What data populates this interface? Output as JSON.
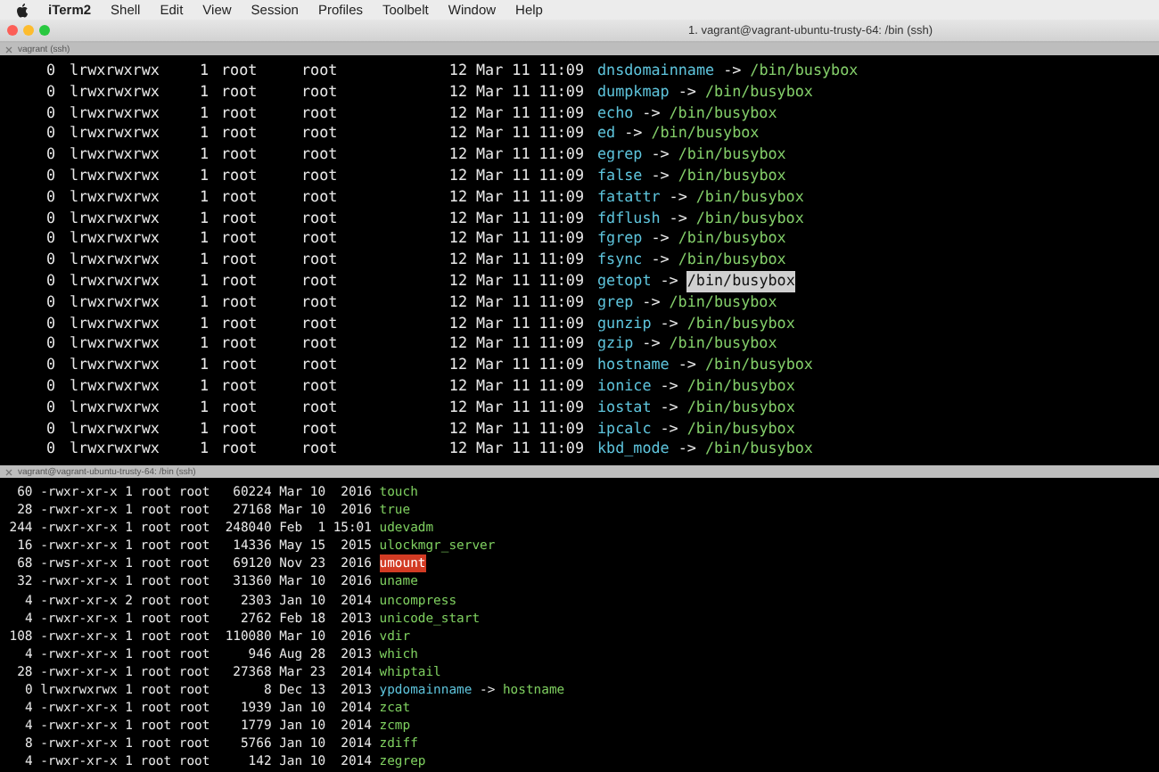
{
  "menu_bar": {
    "app": "iTerm2",
    "items": [
      "Shell",
      "Edit",
      "View",
      "Session",
      "Profiles",
      "Toolbelt",
      "Window",
      "Help"
    ]
  },
  "window": {
    "title": "1. vagrant@vagrant-ubuntu-trusty-64: /bin (ssh)"
  },
  "top_pane": {
    "tab_title": "vagrant (ssh)",
    "rows": [
      {
        "blocks": "0",
        "mode": "lrwxrwxrwx",
        "links": "1",
        "owner": "root",
        "group": "root",
        "size": "12",
        "date": "Mar 11 11:09",
        "name": "dnsdomainname",
        "arrow": "->",
        "target": "/bin/busybox",
        "selected": false
      },
      {
        "blocks": "0",
        "mode": "lrwxrwxrwx",
        "links": "1",
        "owner": "root",
        "group": "root",
        "size": "12",
        "date": "Mar 11 11:09",
        "name": "dumpkmap",
        "arrow": "->",
        "target": "/bin/busybox",
        "selected": false
      },
      {
        "blocks": "0",
        "mode": "lrwxrwxrwx",
        "links": "1",
        "owner": "root",
        "group": "root",
        "size": "12",
        "date": "Mar 11 11:09",
        "name": "echo",
        "arrow": "->",
        "target": "/bin/busybox",
        "selected": false
      },
      {
        "blocks": "0",
        "mode": "lrwxrwxrwx",
        "links": "1",
        "owner": "root",
        "group": "root",
        "size": "12",
        "date": "Mar 11 11:09",
        "name": "ed",
        "arrow": "->",
        "target": "/bin/busybox",
        "selected": false
      },
      {
        "blocks": "0",
        "mode": "lrwxrwxrwx",
        "links": "1",
        "owner": "root",
        "group": "root",
        "size": "12",
        "date": "Mar 11 11:09",
        "name": "egrep",
        "arrow": "->",
        "target": "/bin/busybox",
        "selected": false
      },
      {
        "blocks": "0",
        "mode": "lrwxrwxrwx",
        "links": "1",
        "owner": "root",
        "group": "root",
        "size": "12",
        "date": "Mar 11 11:09",
        "name": "false",
        "arrow": "->",
        "target": "/bin/busybox",
        "selected": false
      },
      {
        "blocks": "0",
        "mode": "lrwxrwxrwx",
        "links": "1",
        "owner": "root",
        "group": "root",
        "size": "12",
        "date": "Mar 11 11:09",
        "name": "fatattr",
        "arrow": "->",
        "target": "/bin/busybox",
        "selected": false
      },
      {
        "blocks": "0",
        "mode": "lrwxrwxrwx",
        "links": "1",
        "owner": "root",
        "group": "root",
        "size": "12",
        "date": "Mar 11 11:09",
        "name": "fdflush",
        "arrow": "->",
        "target": "/bin/busybox",
        "selected": false
      },
      {
        "blocks": "0",
        "mode": "lrwxrwxrwx",
        "links": "1",
        "owner": "root",
        "group": "root",
        "size": "12",
        "date": "Mar 11 11:09",
        "name": "fgrep",
        "arrow": "->",
        "target": "/bin/busybox",
        "selected": false
      },
      {
        "blocks": "0",
        "mode": "lrwxrwxrwx",
        "links": "1",
        "owner": "root",
        "group": "root",
        "size": "12",
        "date": "Mar 11 11:09",
        "name": "fsync",
        "arrow": "->",
        "target": "/bin/busybox",
        "selected": false
      },
      {
        "blocks": "0",
        "mode": "lrwxrwxrwx",
        "links": "1",
        "owner": "root",
        "group": "root",
        "size": "12",
        "date": "Mar 11 11:09",
        "name": "getopt",
        "arrow": "->",
        "target": "/bin/busybox",
        "selected": true
      },
      {
        "blocks": "0",
        "mode": "lrwxrwxrwx",
        "links": "1",
        "owner": "root",
        "group": "root",
        "size": "12",
        "date": "Mar 11 11:09",
        "name": "grep",
        "arrow": "->",
        "target": "/bin/busybox",
        "selected": false
      },
      {
        "blocks": "0",
        "mode": "lrwxrwxrwx",
        "links": "1",
        "owner": "root",
        "group": "root",
        "size": "12",
        "date": "Mar 11 11:09",
        "name": "gunzip",
        "arrow": "->",
        "target": "/bin/busybox",
        "selected": false
      },
      {
        "blocks": "0",
        "mode": "lrwxrwxrwx",
        "links": "1",
        "owner": "root",
        "group": "root",
        "size": "12",
        "date": "Mar 11 11:09",
        "name": "gzip",
        "arrow": "->",
        "target": "/bin/busybox",
        "selected": false
      },
      {
        "blocks": "0",
        "mode": "lrwxrwxrwx",
        "links": "1",
        "owner": "root",
        "group": "root",
        "size": "12",
        "date": "Mar 11 11:09",
        "name": "hostname",
        "arrow": "->",
        "target": "/bin/busybox",
        "selected": false
      },
      {
        "blocks": "0",
        "mode": "lrwxrwxrwx",
        "links": "1",
        "owner": "root",
        "group": "root",
        "size": "12",
        "date": "Mar 11 11:09",
        "name": "ionice",
        "arrow": "->",
        "target": "/bin/busybox",
        "selected": false
      },
      {
        "blocks": "0",
        "mode": "lrwxrwxrwx",
        "links": "1",
        "owner": "root",
        "group": "root",
        "size": "12",
        "date": "Mar 11 11:09",
        "name": "iostat",
        "arrow": "->",
        "target": "/bin/busybox",
        "selected": false
      },
      {
        "blocks": "0",
        "mode": "lrwxrwxrwx",
        "links": "1",
        "owner": "root",
        "group": "root",
        "size": "12",
        "date": "Mar 11 11:09",
        "name": "ipcalc",
        "arrow": "->",
        "target": "/bin/busybox",
        "selected": false
      },
      {
        "blocks": "0",
        "mode": "lrwxrwxrwx",
        "links": "1",
        "owner": "root",
        "group": "root",
        "size": "12",
        "date": "Mar 11 11:09",
        "name": "kbd_mode",
        "arrow": "->",
        "target": "/bin/busybox",
        "selected": false
      }
    ]
  },
  "bottom_pane": {
    "tab_title": "vagrant@vagrant-ubuntu-trusty-64: /bin (ssh)",
    "rows": [
      {
        "kind": "exec",
        "blocks": "60",
        "mode": "-rwxr-xr-x",
        "links": "1",
        "owner": "root",
        "group": "root",
        "size": "60224",
        "month": "Mar",
        "day": "10",
        "time": "2016",
        "name": "touch"
      },
      {
        "kind": "exec",
        "blocks": "28",
        "mode": "-rwxr-xr-x",
        "links": "1",
        "owner": "root",
        "group": "root",
        "size": "27168",
        "month": "Mar",
        "day": "10",
        "time": "2016",
        "name": "true"
      },
      {
        "kind": "exec",
        "blocks": "244",
        "mode": "-rwxr-xr-x",
        "links": "1",
        "owner": "root",
        "group": "root",
        "size": "248040",
        "month": "Feb",
        "day": "1",
        "time": "15:01",
        "name": "udevadm"
      },
      {
        "kind": "exec",
        "blocks": "16",
        "mode": "-rwxr-xr-x",
        "links": "1",
        "owner": "root",
        "group": "root",
        "size": "14336",
        "month": "May",
        "day": "15",
        "time": "2015",
        "name": "ulockmgr_server"
      },
      {
        "kind": "setuid",
        "blocks": "68",
        "mode": "-rwsr-xr-x",
        "links": "1",
        "owner": "root",
        "group": "root",
        "size": "69120",
        "month": "Nov",
        "day": "23",
        "time": "2016",
        "name": "umount"
      },
      {
        "kind": "exec",
        "blocks": "32",
        "mode": "-rwxr-xr-x",
        "links": "1",
        "owner": "root",
        "group": "root",
        "size": "31360",
        "month": "Mar",
        "day": "10",
        "time": "2016",
        "name": "uname"
      },
      {
        "kind": "exec",
        "blocks": "4",
        "mode": "-rwxr-xr-x",
        "links": "2",
        "owner": "root",
        "group": "root",
        "size": "2303",
        "month": "Jan",
        "day": "10",
        "time": "2014",
        "name": "uncompress"
      },
      {
        "kind": "exec",
        "blocks": "4",
        "mode": "-rwxr-xr-x",
        "links": "1",
        "owner": "root",
        "group": "root",
        "size": "2762",
        "month": "Feb",
        "day": "18",
        "time": "2013",
        "name": "unicode_start"
      },
      {
        "kind": "exec",
        "blocks": "108",
        "mode": "-rwxr-xr-x",
        "links": "1",
        "owner": "root",
        "group": "root",
        "size": "110080",
        "month": "Mar",
        "day": "10",
        "time": "2016",
        "name": "vdir"
      },
      {
        "kind": "exec",
        "blocks": "4",
        "mode": "-rwxr-xr-x",
        "links": "1",
        "owner": "root",
        "group": "root",
        "size": "946",
        "month": "Aug",
        "day": "28",
        "time": "2013",
        "name": "which"
      },
      {
        "kind": "exec",
        "blocks": "28",
        "mode": "-rwxr-xr-x",
        "links": "1",
        "owner": "root",
        "group": "root",
        "size": "27368",
        "month": "Mar",
        "day": "23",
        "time": "2014",
        "name": "whiptail"
      },
      {
        "kind": "symlink",
        "blocks": "0",
        "mode": "lrwxrwxrwx",
        "links": "1",
        "owner": "root",
        "group": "root",
        "size": "8",
        "month": "Dec",
        "day": "13",
        "time": "2013",
        "name": "ypdomainname",
        "arrow": "->",
        "target": "hostname"
      },
      {
        "kind": "exec",
        "blocks": "4",
        "mode": "-rwxr-xr-x",
        "links": "1",
        "owner": "root",
        "group": "root",
        "size": "1939",
        "month": "Jan",
        "day": "10",
        "time": "2014",
        "name": "zcat"
      },
      {
        "kind": "exec",
        "blocks": "4",
        "mode": "-rwxr-xr-x",
        "links": "1",
        "owner": "root",
        "group": "root",
        "size": "1779",
        "month": "Jan",
        "day": "10",
        "time": "2014",
        "name": "zcmp"
      },
      {
        "kind": "exec",
        "blocks": "8",
        "mode": "-rwxr-xr-x",
        "links": "1",
        "owner": "root",
        "group": "root",
        "size": "5766",
        "month": "Jan",
        "day": "10",
        "time": "2014",
        "name": "zdiff"
      },
      {
        "kind": "exec",
        "blocks": "4",
        "mode": "-rwxr-xr-x",
        "links": "1",
        "owner": "root",
        "group": "root",
        "size": "142",
        "month": "Jan",
        "day": "10",
        "time": "2014",
        "name": "zegrep"
      }
    ]
  }
}
